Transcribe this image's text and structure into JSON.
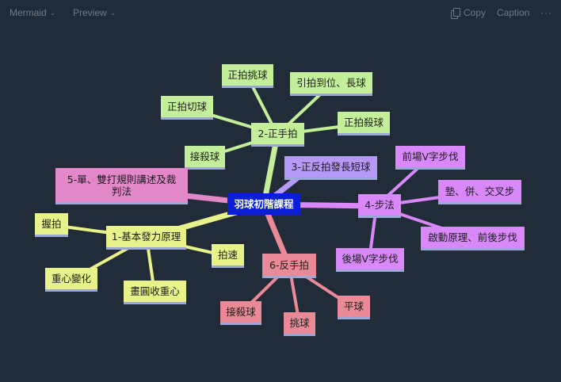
{
  "toolbar": {
    "mermaid_label": "Mermaid",
    "preview_label": "Preview",
    "copy_label": "Copy",
    "caption_label": "Caption",
    "more_label": "···"
  },
  "mindmap": {
    "root": "羽球初階課程",
    "branches": [
      {
        "label": "2-正手拍",
        "children": [
          "正拍挑球",
          "引拍到位、長球",
          "正拍切球",
          "正拍殺球",
          "接殺球"
        ]
      },
      {
        "label": "3-正反拍發長短球",
        "children": []
      },
      {
        "label": "4-步法",
        "children": [
          "前場V字步伐",
          "墊、併、交叉步",
          "啟動原理、前後步伐",
          "後場V字步伐"
        ]
      },
      {
        "label": "5-單、雙打規則講述及裁判法",
        "children": []
      },
      {
        "label": "1-基本發力原理",
        "children": [
          "握拍",
          "拍速",
          "重心變化",
          "畫圓收重心"
        ]
      },
      {
        "label": "6-反手拍",
        "children": [
          "接殺球",
          "挑球",
          "平球"
        ]
      }
    ]
  },
  "colors": {
    "background": "#222b38",
    "root": "#0a1ed8",
    "green": "#c3ef9a",
    "yellow": "#e8f28a",
    "purple": "#d888f8",
    "violet": "#b698f6",
    "pink": "#e288c8",
    "red": "#ea8a96"
  }
}
